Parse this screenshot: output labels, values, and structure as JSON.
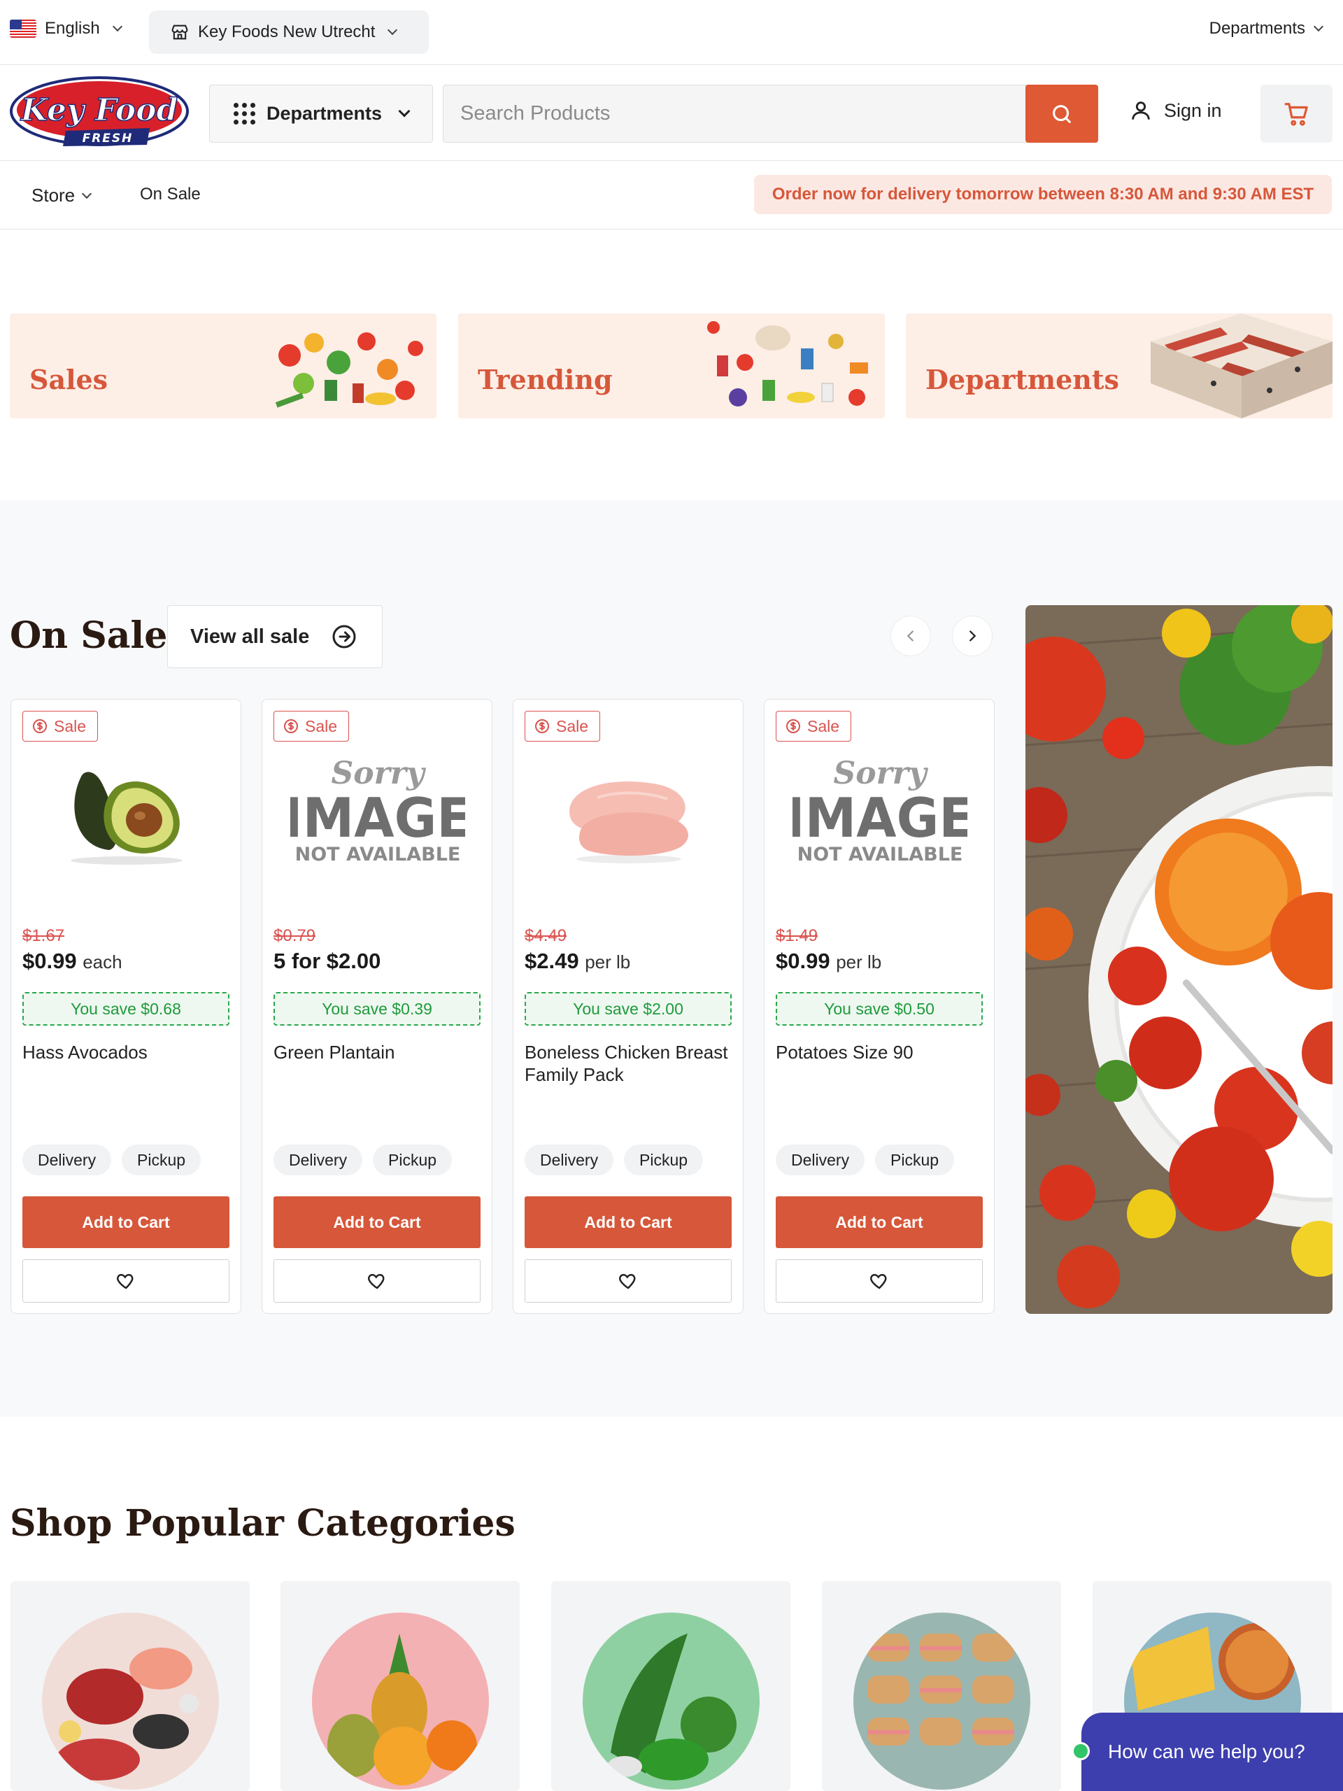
{
  "utility": {
    "language": "English",
    "store_name": "Key Foods New Utrecht",
    "departments_link": "Departments"
  },
  "header": {
    "logo_main": "Key Food",
    "logo_sub": "FRESH",
    "departments_button": "Departments",
    "search_placeholder": "Search Products",
    "sign_in": "Sign in"
  },
  "subnav": {
    "store": "Store",
    "on_sale": "On Sale",
    "delivery_banner": "Order now for delivery tomorrow between 8:30 AM and 9:30 AM EST"
  },
  "tiles": [
    {
      "label": "Sales"
    },
    {
      "label": "Trending"
    },
    {
      "label": "Departments"
    }
  ],
  "on_sale": {
    "title": "On Sale",
    "view_all": "View all sale",
    "products": [
      {
        "badge": "Sale",
        "old_price": "$1.67",
        "price": "$0.99",
        "unit": "each",
        "save": "You save $0.68",
        "name": "Hass Avocados",
        "delivery": "Delivery",
        "pickup": "Pickup",
        "add": "Add to Cart",
        "image": "avocado"
      },
      {
        "badge": "Sale",
        "old_price": "$0.79",
        "price": "5 for $2.00",
        "unit": "",
        "save": "You save $0.39",
        "name": "Green Plantain",
        "delivery": "Delivery",
        "pickup": "Pickup",
        "add": "Add to Cart",
        "image": "not-available",
        "na_line1": "Sorry",
        "na_line2": "IMAGE",
        "na_line3": "NOT AVAILABLE"
      },
      {
        "badge": "Sale",
        "old_price": "$4.49",
        "price": "$2.49",
        "unit": "per lb",
        "save": "You save $2.00",
        "name": "Boneless Chicken Breast Family Pack",
        "delivery": "Delivery",
        "pickup": "Pickup",
        "add": "Add to Cart",
        "image": "chicken"
      },
      {
        "badge": "Sale",
        "old_price": "$1.49",
        "price": "$0.99",
        "unit": "per lb",
        "save": "You save $0.50",
        "name": "Potatoes Size 90",
        "delivery": "Delivery",
        "pickup": "Pickup",
        "add": "Add to Cart",
        "image": "not-available",
        "na_line1": "Sorry",
        "na_line2": "IMAGE",
        "na_line3": "NOT AVAILABLE"
      }
    ]
  },
  "popular": {
    "title": "Shop Popular Categories"
  },
  "chat": {
    "prompt": "How can we help you?"
  },
  "colors": {
    "brand_orange": "#de5934",
    "sale_red": "#d9534f",
    "save_green": "#1f9a3c",
    "chat_blue": "#3d3fae"
  }
}
